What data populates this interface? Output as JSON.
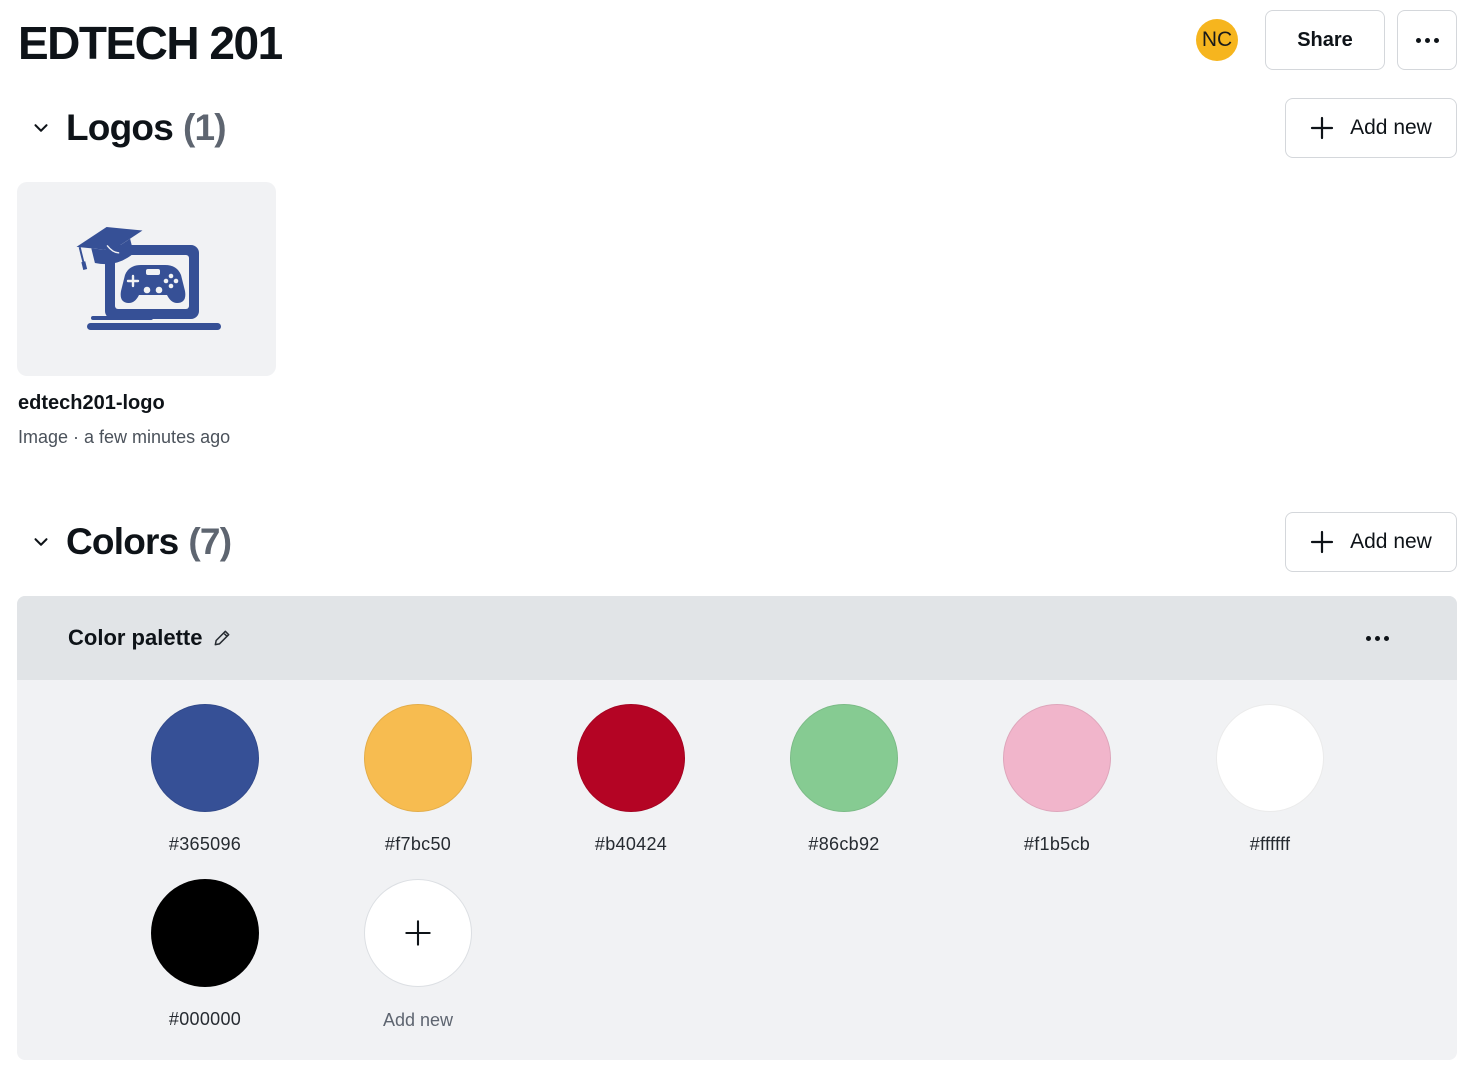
{
  "header": {
    "title": "EDTECH 201",
    "avatar_initials": "NC",
    "avatar_color": "#f6b51e",
    "share_label": "Share",
    "more_icon": "more-horizontal-icon"
  },
  "logos": {
    "title": "Logos",
    "count": "(1)",
    "add_label": "Add new",
    "items": [
      {
        "name": "edtech201-logo",
        "meta": "Image · a few minutes ago",
        "icon": "laptop-gamepad-graduation-cap-logo",
        "color": "#365096"
      }
    ]
  },
  "colors": {
    "title": "Colors",
    "count": "(7)",
    "add_label": "Add new",
    "palette": {
      "name": "Color palette",
      "swatches": [
        {
          "hex": "#365096"
        },
        {
          "hex": "#f7bc50"
        },
        {
          "hex": "#b40424"
        },
        {
          "hex": "#86cb92"
        },
        {
          "hex": "#f1b5cb"
        },
        {
          "hex": "#ffffff"
        },
        {
          "hex": "#000000"
        }
      ],
      "add_label": "Add new"
    }
  }
}
